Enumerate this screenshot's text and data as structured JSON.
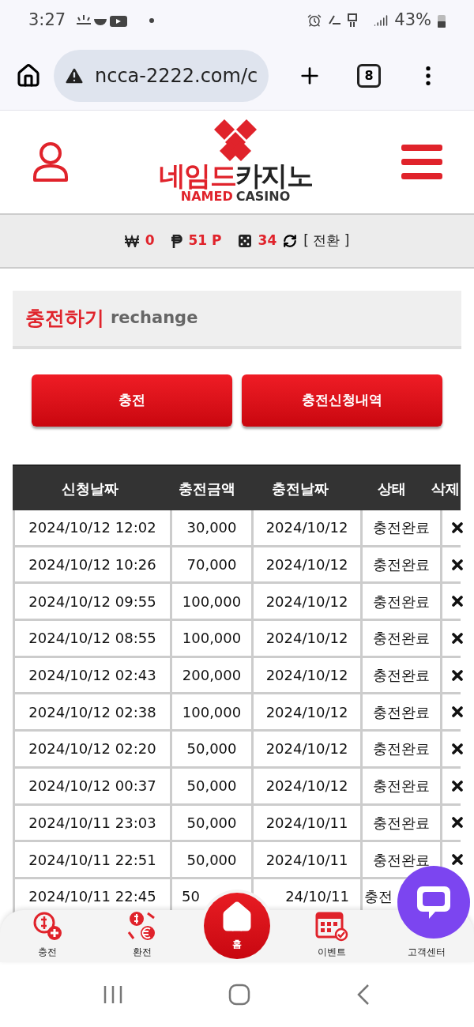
{
  "status_bar": {
    "time": "3:27",
    "battery": "43%"
  },
  "browser": {
    "url": "ncca-2222.com/c",
    "tab_count": "8"
  },
  "header": {
    "logo_korean_red": "네임드",
    "logo_korean_dark": "카지노",
    "logo_english_red": "NAMED",
    "logo_english_dark": "CASINO"
  },
  "balance": {
    "won_value": "0",
    "point_value": "51 P",
    "dice_value": "34",
    "switch_label": "[ 전환 ]"
  },
  "section": {
    "title": "충전하기",
    "subtitle": "rechange"
  },
  "buttons": [
    "충전",
    "충전신청내역"
  ],
  "table": {
    "columns": [
      "신청날짜",
      "충전금액",
      "충전날짜",
      "상태",
      "삭제"
    ],
    "rows": [
      {
        "requested": "2024/10/12 12:02",
        "amount": "30,000",
        "charged": "2024/10/12",
        "status": "충전완료",
        "delete_visible": true
      },
      {
        "requested": "2024/10/12 10:26",
        "amount": "70,000",
        "charged": "2024/10/12",
        "status": "충전완료",
        "delete_visible": true
      },
      {
        "requested": "2024/10/12 09:55",
        "amount": "100,000",
        "charged": "2024/10/12",
        "status": "충전완료",
        "delete_visible": true
      },
      {
        "requested": "2024/10/12 08:55",
        "amount": "100,000",
        "charged": "2024/10/12",
        "status": "충전완료",
        "delete_visible": true
      },
      {
        "requested": "2024/10/12 02:43",
        "amount": "200,000",
        "charged": "2024/10/12",
        "status": "충전완료",
        "delete_visible": true
      },
      {
        "requested": "2024/10/12 02:38",
        "amount": "100,000",
        "charged": "2024/10/12",
        "status": "충전완료",
        "delete_visible": true
      },
      {
        "requested": "2024/10/12 02:20",
        "amount": "50,000",
        "charged": "2024/10/12",
        "status": "충전완료",
        "delete_visible": true
      },
      {
        "requested": "2024/10/12 00:37",
        "amount": "50,000",
        "charged": "2024/10/12",
        "status": "충전완료",
        "delete_visible": true
      },
      {
        "requested": "2024/10/11 23:03",
        "amount": "50,000",
        "charged": "2024/10/11",
        "status": "충전완료",
        "delete_visible": true
      },
      {
        "requested": "2024/10/11 22:51",
        "amount": "50,000",
        "charged": "2024/10/11",
        "status": "충전완료",
        "delete_visible": true
      },
      {
        "kind": "partial",
        "requested": "2024/10/11 22:45",
        "amount": "50",
        "charged": "24/10/11",
        "status": "충전"
      }
    ]
  },
  "bottom_nav": [
    {
      "kind": "deposit",
      "label": "충전"
    },
    {
      "kind": "exchange",
      "label": "환전"
    },
    {
      "kind": "home",
      "label": "홈"
    },
    {
      "kind": "event",
      "label": "이벤트"
    },
    {
      "kind": "support",
      "label": "고객센터"
    }
  ]
}
